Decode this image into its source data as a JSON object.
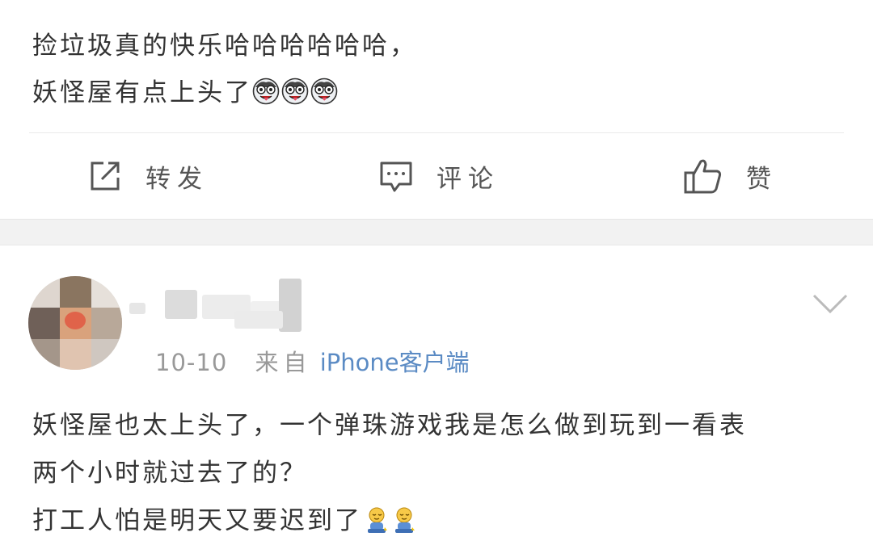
{
  "post": {
    "lines": [
      "捡垃圾真的快乐哈哈哈哈哈哈，",
      "妖怪屋有点上头了"
    ],
    "emoji_name": "crazy-face-emoji",
    "emoji_count": 3
  },
  "actions": {
    "repost_label": "转发",
    "comment_label": "评论",
    "like_label": "赞"
  },
  "comment": {
    "time": "10-10",
    "source_prefix": "来自",
    "client": "iPhone客户端",
    "lines": [
      "妖怪屋也太上头了，一个弹珠游戏我是怎么做到玩到一看表",
      "两个小时就过去了的？",
      "打工人怕是明天又要迟到了"
    ],
    "emoji_name": "sleepy-man-emoji",
    "emoji_count": 2
  },
  "colors": {
    "text": "#333333",
    "meta": "#999999",
    "link": "#5b8bc4",
    "band": "#f2f2f2"
  }
}
